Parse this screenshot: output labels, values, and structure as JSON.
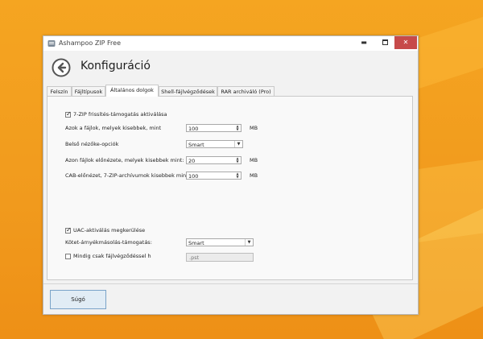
{
  "window": {
    "title": "Ashampoo ZIP Free",
    "page_title": "Konfiguráció"
  },
  "tabs": [
    {
      "label": "Felszín"
    },
    {
      "label": "Fájltípusok"
    },
    {
      "label": "Általános dolgok",
      "active": true
    },
    {
      "label": "Shell-fájlvégződések"
    },
    {
      "label": "RAR archiváló (Pro)"
    }
  ],
  "settings": {
    "zip7_support": {
      "label": "7-ZIP frissítés-támogatás aktiválása",
      "checked": true
    },
    "files_smaller_than": {
      "label": "Azok a fájlok, melyek kisebbek, mint",
      "value": "100",
      "unit": "MB"
    },
    "internal_viewer": {
      "label": "Belső nézőke-opciók",
      "value": "Smart"
    },
    "preview_smaller_than": {
      "label": "Azon fájlok előnézete, melyek kisebbek mint:",
      "value": "20",
      "unit": "MB"
    },
    "cab_preview": {
      "label": "CAB-előnézet, 7-ZIP-archívumok kisebbek mint:",
      "value": "100",
      "unit": "MB"
    },
    "uac_bypass": {
      "label": "UAC-aktiválás megkerülése",
      "checked": true
    },
    "volume_shadow": {
      "label": "Kötet-árnyékmásolás-támogatás:",
      "value": "Smart"
    },
    "always_extension": {
      "label": "Mindig csak fájlvégződéssel h",
      "checked": false,
      "value": ".pst"
    }
  },
  "footer": {
    "help_label": "Súgó"
  },
  "colors": {
    "desktop": "#f19a1d",
    "close_button": "#c74a4a",
    "help_button_border": "#7aa3c8"
  }
}
